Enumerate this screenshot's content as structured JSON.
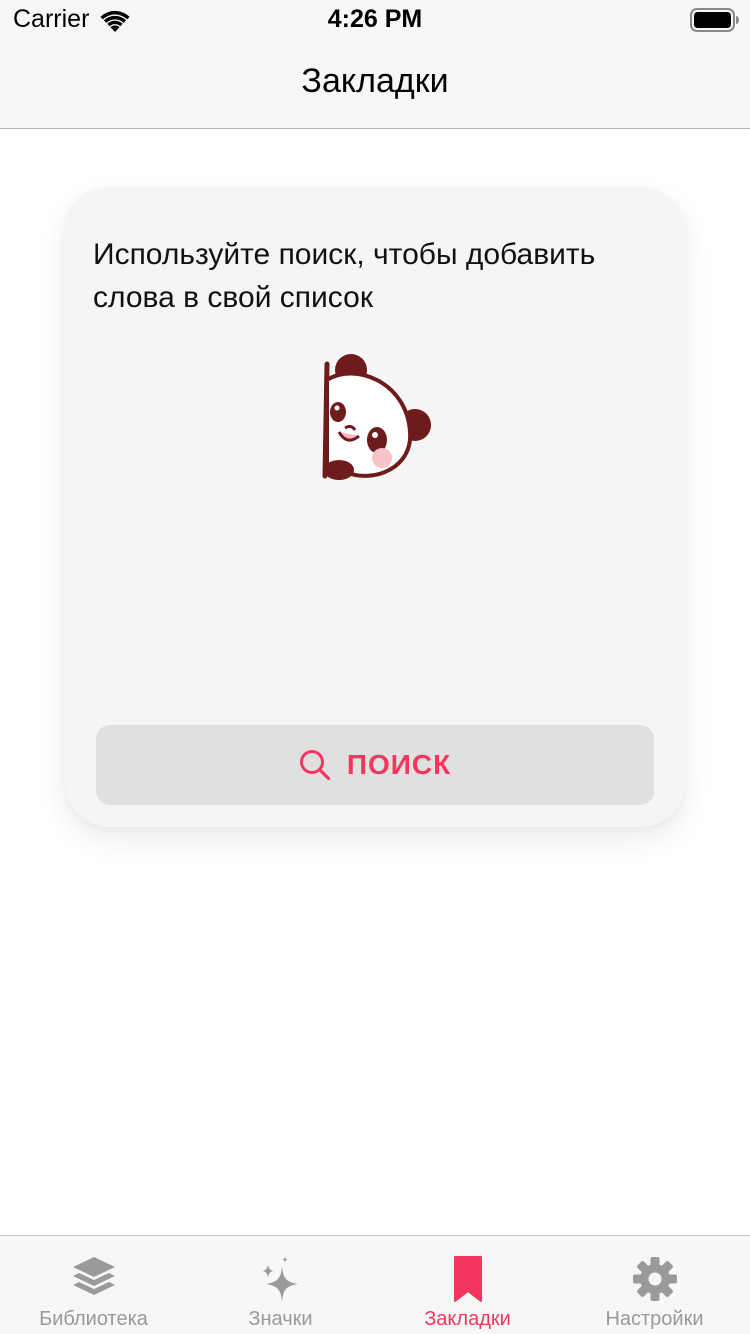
{
  "status_bar": {
    "carrier": "Carrier",
    "time": "4:26 PM"
  },
  "nav": {
    "title": "Закладки"
  },
  "empty_state": {
    "message": "Используйте поиск, чтобы добавить слова в свой список",
    "illustration": "panda-icon",
    "search_button_label": "ПОИСК",
    "search_button_icon": "search-icon"
  },
  "tab_bar": {
    "active_color": "#f4365e",
    "inactive_color": "#999999",
    "tabs": [
      {
        "label": "Библиотека",
        "icon": "layers-icon",
        "active": false
      },
      {
        "label": "Значки",
        "icon": "sparkles-icon",
        "active": false
      },
      {
        "label": "Закладки",
        "icon": "bookmark-icon",
        "active": true
      },
      {
        "label": "Настройки",
        "icon": "gear-icon",
        "active": false
      }
    ]
  }
}
